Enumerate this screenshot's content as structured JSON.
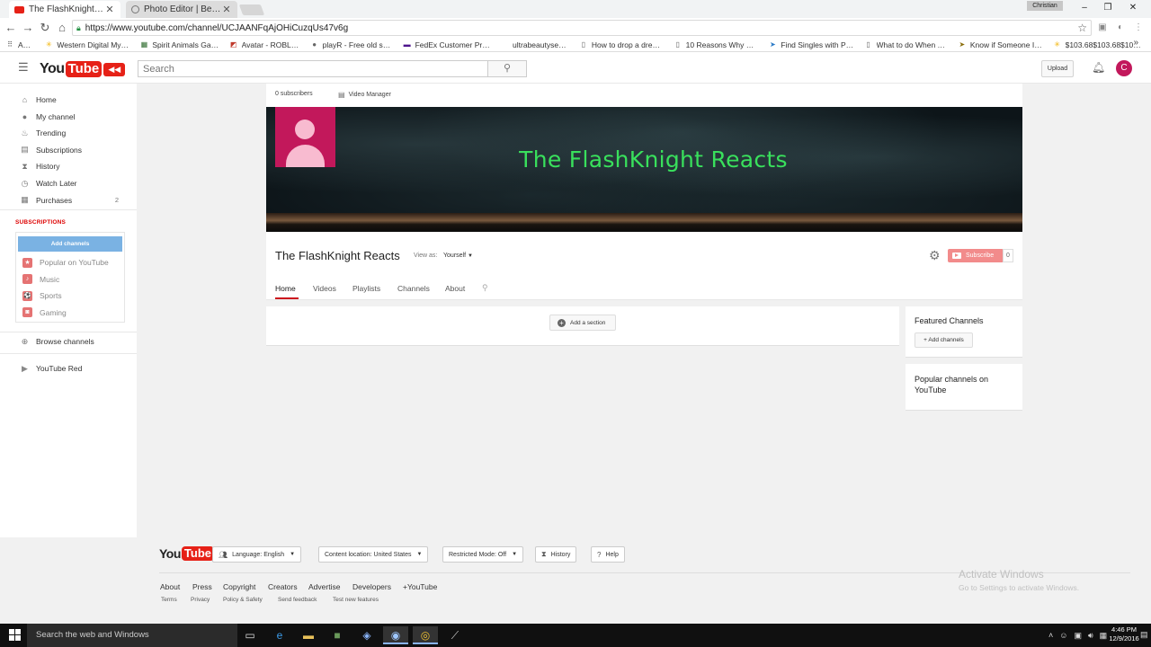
{
  "browser": {
    "tabs": [
      {
        "title": "The FlashKnight Reacts -",
        "active": true,
        "favicon": "youtube-icon"
      },
      {
        "title": "Photo Editor | BeFunky: F",
        "active": false,
        "favicon": "befunky-icon"
      }
    ],
    "profile": "Christian",
    "url": "https://www.youtube.com/channel/UCJAANFqAjOHiCuzqUs47v6g",
    "bookmarks": [
      {
        "label": "Apps",
        "icon": "apps-grid-icon"
      },
      {
        "label": "Western Digital My Pa",
        "icon": "walmart-star-icon"
      },
      {
        "label": "Spirit Animals Game",
        "icon": "spirit-animals-icon"
      },
      {
        "label": "Avatar - ROBLOX",
        "icon": "roblox-icon"
      },
      {
        "label": "playR - Free old scho",
        "icon": "playr-icon"
      },
      {
        "label": "FedEx Customer Prote",
        "icon": "fedex-icon"
      },
      {
        "label": "ultrabeautysecret",
        "icon": "blank-icon"
      },
      {
        "label": "How to drop a dress s",
        "icon": "page-icon"
      },
      {
        "label": "10 Reasons Why Men",
        "icon": "page-icon"
      },
      {
        "label": "Find Singles with POF",
        "icon": "pof-icon"
      },
      {
        "label": "What to do When You",
        "icon": "page-icon"
      },
      {
        "label": "Know if Someone Is S",
        "icon": "arrow-icon"
      },
      {
        "label": "$103.68$103.68$103.6",
        "icon": "walmart-star-icon"
      }
    ]
  },
  "yt": {
    "search_placeholder": "Search",
    "upload_label": "Upload",
    "avatar_letter": "C"
  },
  "sidebar": {
    "items": [
      {
        "label": "Home",
        "icon": "home-icon",
        "glyph": "⌂"
      },
      {
        "label": "My channel",
        "icon": "person-icon",
        "glyph": "●"
      },
      {
        "label": "Trending",
        "icon": "flame-icon",
        "glyph": "♨"
      },
      {
        "label": "Subscriptions",
        "icon": "subscriptions-icon",
        "glyph": "▤"
      },
      {
        "label": "History",
        "icon": "hourglass-icon",
        "glyph": "⧗"
      },
      {
        "label": "Watch Later",
        "icon": "clock-icon",
        "glyph": "◷"
      },
      {
        "label": "Purchases",
        "icon": "purchases-icon",
        "glyph": "▦",
        "count": "2"
      }
    ],
    "subscriptions_heading": "SUBSCRIPTIONS",
    "add_channels_label": "Add channels",
    "subscription_items": [
      {
        "label": "Popular on YouTube",
        "icon": "star-icon",
        "glyph": "★"
      },
      {
        "label": "Music",
        "icon": "music-icon",
        "glyph": "♪"
      },
      {
        "label": "Sports",
        "icon": "sports-icon",
        "glyph": "⚽"
      },
      {
        "label": "Gaming",
        "icon": "gaming-icon",
        "glyph": "◙"
      }
    ],
    "browse_channels": "Browse channels",
    "youtube_red": "YouTube Red"
  },
  "channel": {
    "subscribers_text": "0 subscribers",
    "video_manager": "Video Manager",
    "banner_title": "The FlashKnight Reacts",
    "name": "The FlashKnight Reacts",
    "view_as_label": "View as:",
    "view_as_value": "Yourself",
    "subscribe_label": "Subscribe",
    "subscribe_count": "0",
    "tabs": [
      "Home",
      "Videos",
      "Playlists",
      "Channels",
      "About"
    ],
    "active_tab": "Home",
    "add_section_label": "Add a section",
    "featured_channels_title": "Featured Channels",
    "add_channels_right": "+ Add channels",
    "popular_channels_title": "Popular channels on YouTube"
  },
  "footer": {
    "language_btn": "Language: English",
    "location_btn": "Content location: United States",
    "restricted_btn": "Restricted Mode: Off",
    "history_btn": "History",
    "help_btn": "Help",
    "links": [
      "About",
      "Press",
      "Copyright",
      "Creators",
      "Advertise",
      "Developers",
      "+YouTube"
    ],
    "sublinks": [
      "Terms",
      "Privacy",
      "Policy & Safety",
      "Send feedback",
      "Test new features"
    ],
    "watermark_title": "Activate Windows",
    "watermark_sub": "Go to Settings to activate Windows."
  },
  "taskbar": {
    "search_placeholder": "Search the web and Windows",
    "time": "4:46 PM",
    "date": "12/9/2016"
  }
}
